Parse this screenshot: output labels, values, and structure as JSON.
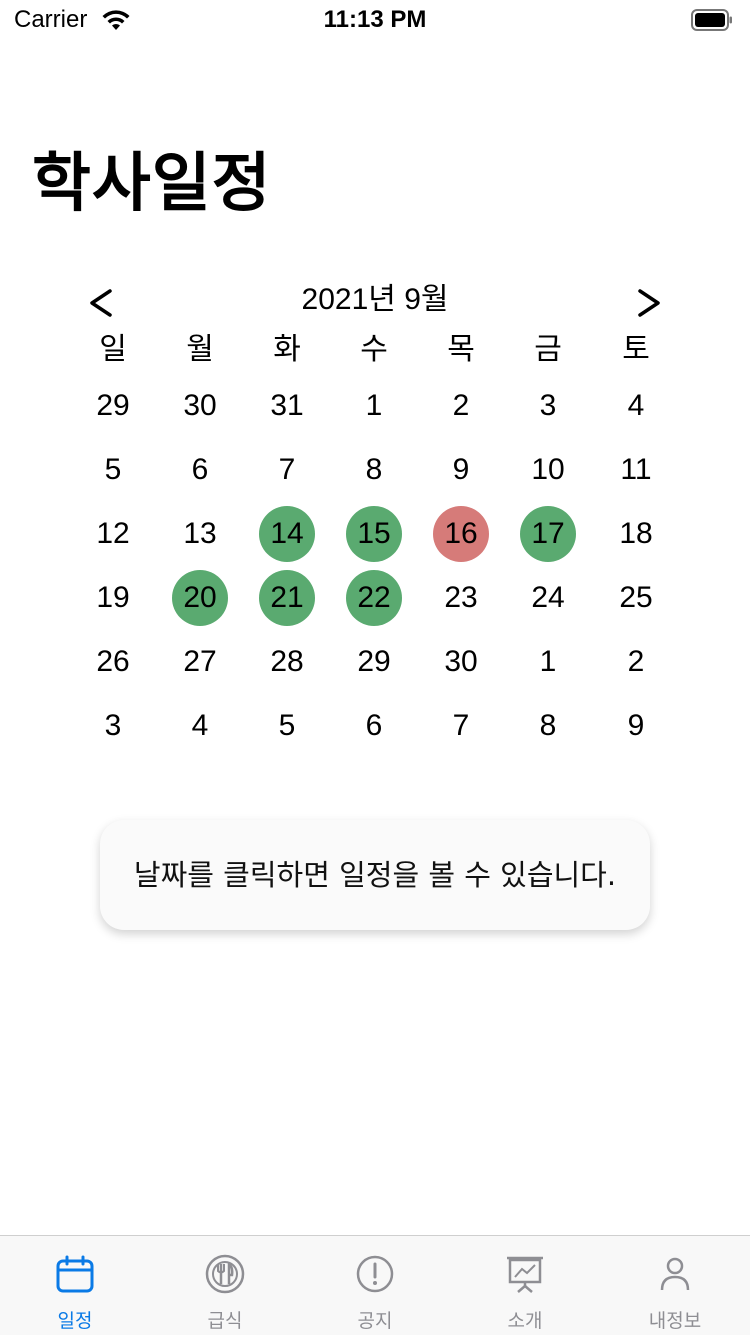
{
  "status_bar": {
    "carrier": "Carrier",
    "time": "11:13 PM"
  },
  "page": {
    "title": "학사일정"
  },
  "calendar": {
    "month_label": "2021년 9월",
    "weekdays": [
      "일",
      "월",
      "화",
      "수",
      "목",
      "금",
      "토"
    ],
    "weeks": [
      [
        "29",
        "30",
        "31",
        "1",
        "2",
        "3",
        "4"
      ],
      [
        "5",
        "6",
        "7",
        "8",
        "9",
        "10",
        "11"
      ],
      [
        "12",
        "13",
        "14",
        "15",
        "16",
        "17",
        "18"
      ],
      [
        "19",
        "20",
        "21",
        "22",
        "23",
        "24",
        "25"
      ],
      [
        "26",
        "27",
        "28",
        "29",
        "30",
        "1",
        "2"
      ],
      [
        "3",
        "4",
        "5",
        "6",
        "7",
        "8",
        "9"
      ]
    ],
    "highlighted_green": [
      "14",
      "15",
      "17",
      "20",
      "21",
      "22"
    ],
    "highlighted_red": [
      "16"
    ],
    "colors": {
      "green": "#5aaa70",
      "red": "#d67b79"
    }
  },
  "hint": {
    "text": "날짜를 클릭하면 일정을 볼 수 있습니다."
  },
  "tab_bar": {
    "active_color": "#0a7ae6",
    "inactive_color": "#8e8e93",
    "items": [
      {
        "label": "일정",
        "icon": "calendar-icon",
        "active": true
      },
      {
        "label": "급식",
        "icon": "meal-icon",
        "active": false
      },
      {
        "label": "공지",
        "icon": "notice-icon",
        "active": false
      },
      {
        "label": "소개",
        "icon": "presentation-icon",
        "active": false
      },
      {
        "label": "내정보",
        "icon": "person-icon",
        "active": false
      }
    ]
  }
}
